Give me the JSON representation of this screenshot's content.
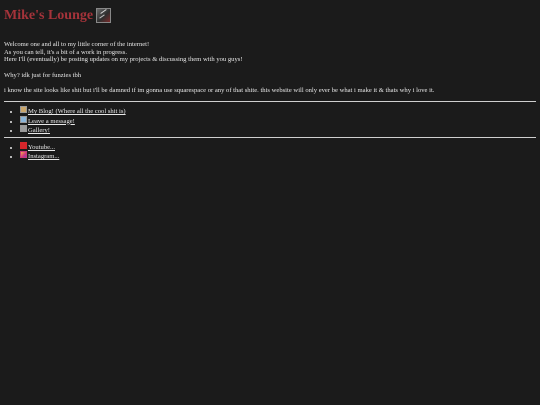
{
  "header": {
    "title": "Mike's Lounge"
  },
  "intro": {
    "line1": "Welcome one and all to my little corner of the internet!",
    "line2": "As you can tell, it's a bit of a work in progress.",
    "line3": "Here I'll (eventually) be posting updates on my projects & discussing them with you guys!"
  },
  "why": "Why? idk just for funzies tbh",
  "disclaimer": "i know the site looks like shit but i'll be damned if im gonna use squarespace or any of that shite. this website will only ever be what i make it & thats why i love it.",
  "nav": {
    "items": [
      {
        "label": "My Blog! (Where all the cool shit is)",
        "icon": "blog-icon"
      },
      {
        "label": "Leave a message!",
        "icon": "message-icon"
      },
      {
        "label": "Gallery!",
        "icon": "gallery-icon"
      }
    ]
  },
  "social": {
    "items": [
      {
        "label": "Youtube...",
        "icon": "youtube-icon"
      },
      {
        "label": "Instagram...",
        "icon": "instagram-icon"
      }
    ]
  },
  "colors": {
    "background": "#1b1b1b",
    "title": "#a5333a",
    "text": "#e8e8e8"
  }
}
